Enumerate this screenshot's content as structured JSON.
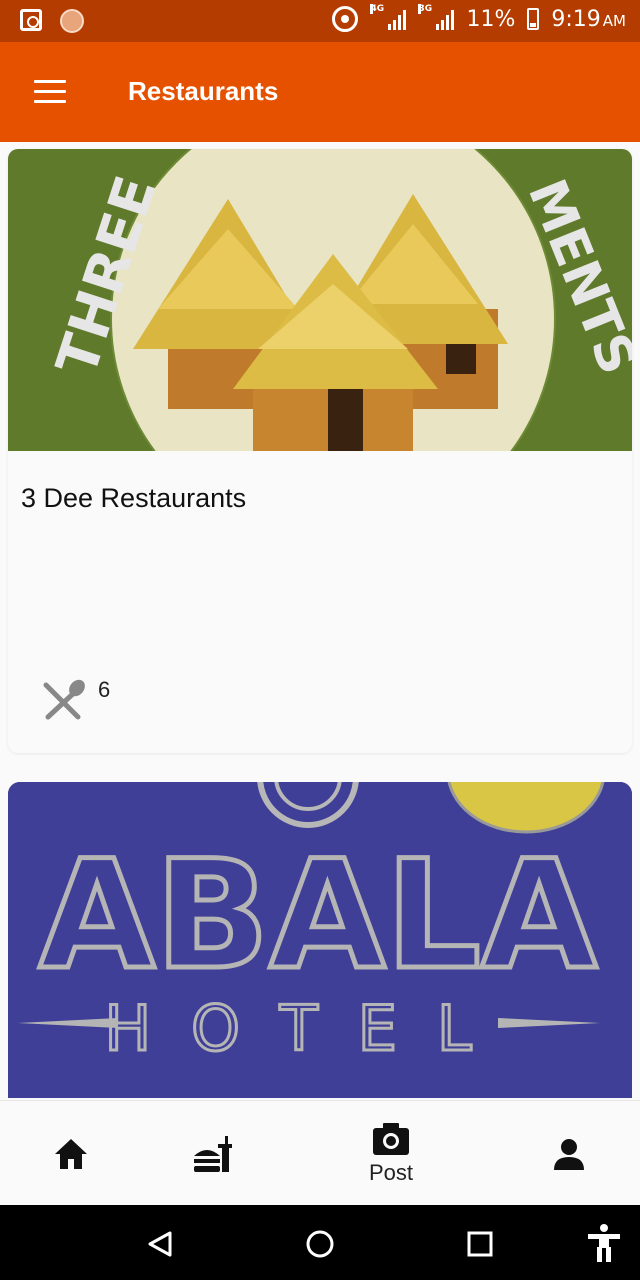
{
  "status_bar": {
    "net1": "4G",
    "net2": "3G",
    "battery": "11%",
    "time": "9:19",
    "ampm": "AM"
  },
  "app_bar": {
    "title": "Restaurants"
  },
  "cards": [
    {
      "title": "3 Dee Restaurants",
      "logo_text_left": "THREE",
      "logo_text_right": "MENTS",
      "meal_count": "6"
    },
    {
      "logo_main": "ABALA",
      "logo_sub": "HOTEL"
    }
  ],
  "bottom_nav": {
    "post_label": "Post"
  },
  "icons": [
    "menu-icon",
    "meal-icon",
    "home-icon",
    "food-icon",
    "camera-icon",
    "person-icon",
    "back-icon",
    "home-circle-icon",
    "recents-icon",
    "accessibility-icon"
  ],
  "colors": {
    "app_bar": "#e65100",
    "status_bar": "#b53c00",
    "card2_bg": "#3f3f97"
  }
}
